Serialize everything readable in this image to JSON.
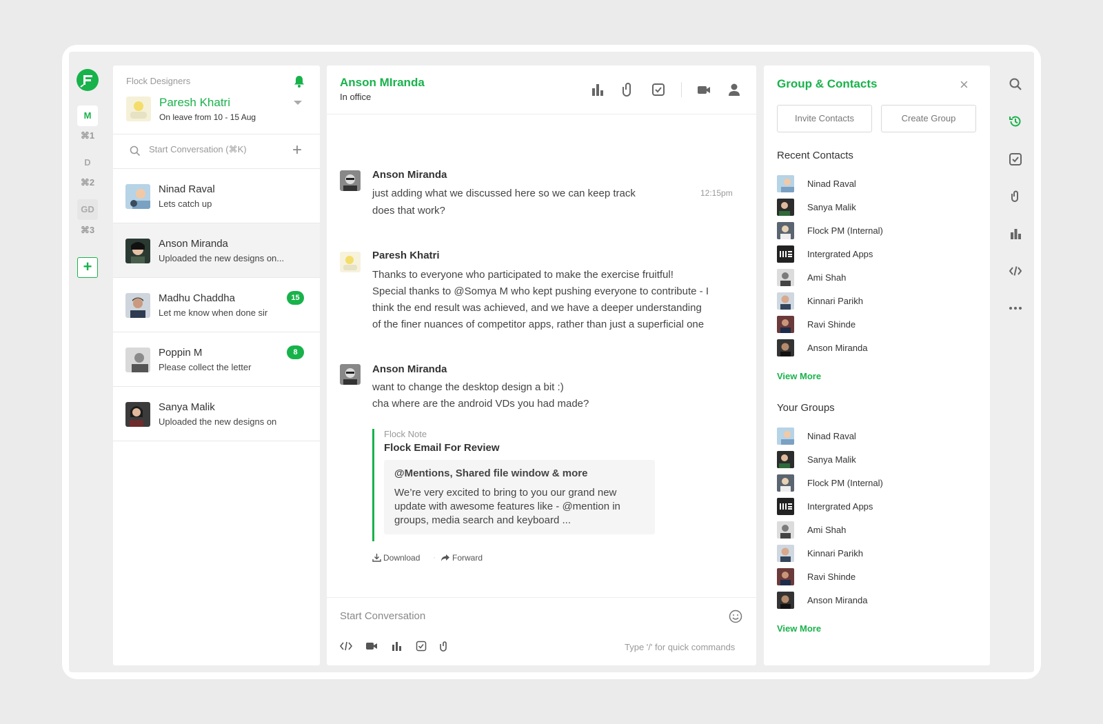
{
  "workspaces": [
    {
      "label": "M",
      "shortcut": "⌘1"
    },
    {
      "label": "D",
      "shortcut": "⌘2"
    },
    {
      "label": "GD",
      "shortcut": "⌘3"
    }
  ],
  "workspace_add": "+",
  "sidebar": {
    "workspace_name": "Flock Designers",
    "me": {
      "name": "Paresh Khatri",
      "status": "On leave from 10 - 15 Aug"
    },
    "search_placeholder": "Start Conversation (⌘K)",
    "new_label": "+",
    "conversations": [
      {
        "name": "Ninad Raval",
        "preview": "Lets catch up",
        "badge": ""
      },
      {
        "name": "Anson Miranda",
        "preview": "Uploaded the new designs on...",
        "badge": ""
      },
      {
        "name": "Madhu Chaddha",
        "preview": "Let me know when done sir",
        "badge": "15"
      },
      {
        "name": "Poppin M",
        "preview": "Please collect the letter",
        "badge": "8"
      },
      {
        "name": "Sanya Malik",
        "preview": "Uploaded the new designs on",
        "badge": ""
      }
    ]
  },
  "chat": {
    "title": "Anson MIranda",
    "status": "In office",
    "header_icons": [
      "poll-icon",
      "attachment-icon",
      "task-icon",
      "video-icon",
      "profile-icon"
    ],
    "messages": [
      {
        "author": "Anson Miranda",
        "time": "12:15pm",
        "lines": [
          "just adding what we discussed here so we can keep track",
          "does that work?"
        ]
      },
      {
        "author": "Paresh Khatri",
        "lines": [
          "Thanks to everyone who participated to make the exercise fruitful!",
          "Special thanks to @Somya M who kept pushing everyone to contribute - I",
          "think the end result was achieved, and we have a deeper understanding",
          "of the finer nuances of competitor apps, rather than just a superficial one"
        ]
      },
      {
        "author": "Anson Miranda",
        "lines": [
          "want to change the desktop design a bit :)",
          "cha where are the android VDs you had made?"
        ],
        "note": {
          "label": "Flock Note",
          "title": "Flock Email For Review",
          "card_title": "@Mentions, Shared file window & more",
          "card_body": "We’re very excited to bring to you our grand new update with awesome features like - @mention in groups, media search and keyboard ..."
        },
        "actions": {
          "download": "Download",
          "separator": "·",
          "forward": "Forward"
        }
      }
    ],
    "composer": {
      "placeholder": "Start Conversation",
      "hint": "Type '/' for quick commands",
      "tools": [
        "code-icon",
        "video-icon",
        "poll-icon",
        "task-icon",
        "attachment-icon"
      ]
    }
  },
  "contacts_panel": {
    "title": "Group & Contacts",
    "close": "×",
    "invite_label": "Invite Contacts",
    "create_label": "Create Group",
    "recent_title": "Recent Contacts",
    "recent": [
      "Ninad Raval",
      "Sanya Malik",
      "Flock PM (Internal)",
      "Intergrated Apps",
      "Ami Shah",
      "Kinnari Parikh",
      "Ravi Shinde",
      "Anson Miranda"
    ],
    "view_more": "View More",
    "groups_title": "Your Groups",
    "groups": [
      "Ninad Raval",
      "Sanya Malik",
      "Flock PM (Internal)",
      "Intergrated Apps",
      "Ami Shah",
      "Kinnari Parikh",
      "Ravi Shinde",
      "Anson Miranda"
    ]
  },
  "right_toolbar": [
    "search-icon",
    "history-icon",
    "task-icon",
    "attachment-icon",
    "poll-icon",
    "code-icon",
    "more-icon"
  ],
  "colors": {
    "accent": "#18b24b",
    "background": "#ebebeb",
    "panel": "#ffffff"
  }
}
